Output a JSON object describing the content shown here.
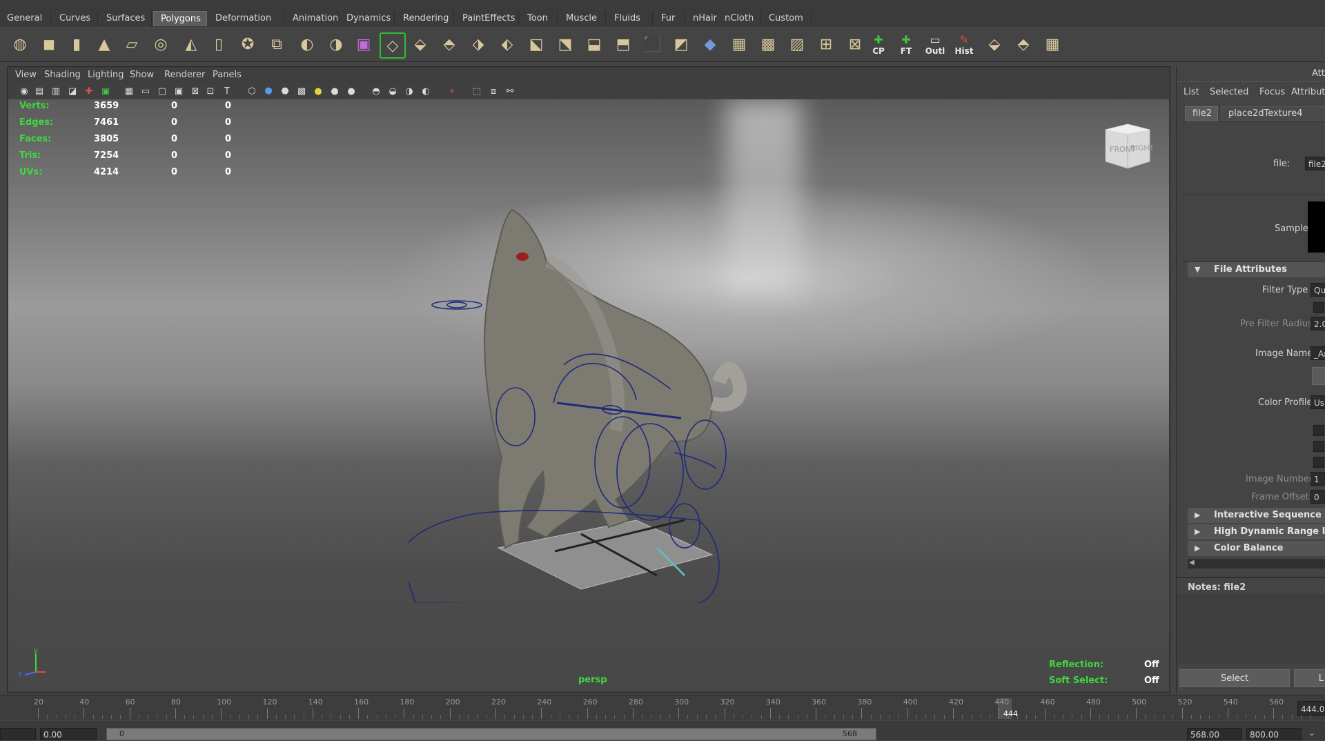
{
  "shelf_tabs": [
    {
      "label": "General"
    },
    {
      "label": "Curves"
    },
    {
      "label": "Surfaces"
    },
    {
      "label": "Polygons",
      "active": true
    },
    {
      "label": "Deformation"
    },
    {
      "label": "Animation"
    },
    {
      "label": "Dynamics"
    },
    {
      "label": "Rendering"
    },
    {
      "label": "PaintEffects"
    },
    {
      "label": "Toon"
    },
    {
      "label": "Muscle"
    },
    {
      "label": "Fluids"
    },
    {
      "label": "Fur"
    },
    {
      "label": "nHair"
    },
    {
      "label": "nCloth"
    },
    {
      "label": "Custom"
    }
  ],
  "shelf_text_buttons": {
    "cp": "CP",
    "ft": "FT",
    "outl": "Outl",
    "hist": "Hist"
  },
  "panel_menu": {
    "view": "View",
    "shading": "Shading",
    "lighting": "Lighting",
    "show": "Show",
    "renderer": "Renderer",
    "panels": "Panels"
  },
  "hud": {
    "rows": [
      {
        "label": "Verts:",
        "v1": "3659",
        "v2": "0",
        "v3": "0"
      },
      {
        "label": "Edges:",
        "v1": "7461",
        "v2": "0",
        "v3": "0"
      },
      {
        "label": "Faces:",
        "v1": "3805",
        "v2": "0",
        "v3": "0"
      },
      {
        "label": "Tris:",
        "v1": "7254",
        "v2": "0",
        "v3": "0"
      },
      {
        "label": "UVs:",
        "v1": "4214",
        "v2": "0",
        "v3": "0"
      }
    ],
    "camera": "persp",
    "reflection_label": "Reflection:",
    "reflection_value": "Off",
    "soft_select_label": "Soft Select:",
    "soft_select_value": "Off",
    "view_cube": {
      "front": "FRONT",
      "right": "RIGHT"
    },
    "axis": {
      "y": "y",
      "z": "z"
    }
  },
  "attribute_editor": {
    "title_fragment": "Att",
    "menu": {
      "list": "List",
      "selected": "Selected",
      "focus": "Focus",
      "attributes": "Attribute"
    },
    "tabs": {
      "file2": "file2",
      "place2d": "place2dTexture4"
    },
    "file_label": "file:",
    "file_value": "file2",
    "sample_label": "Sample",
    "sections": {
      "file_attributes": "File Attributes",
      "interactive_sequence": "Interactive Sequence Ca",
      "hdr": "High Dynamic Range Ima",
      "color_balance": "Color Balance"
    },
    "filter_type_label": "Filter Type",
    "filter_type_value": "Qu",
    "pre_filter_radius_label": "Pre Filter Radius",
    "pre_filter_radius_value": "2.0",
    "image_name_label": "Image Name",
    "image_name_value": "_Ar",
    "color_profile_label": "Color Profile",
    "color_profile_value": "Us",
    "image_number_label": "Image Number",
    "image_number_value": "1",
    "frame_offset_label": "Frame Offset",
    "frame_offset_value": "0",
    "notes": "Notes:  file2",
    "select_button": "Select",
    "load_button_fragment": "L"
  },
  "time_slider": {
    "ticks": [
      "20",
      "40",
      "60",
      "80",
      "100",
      "120",
      "140",
      "160",
      "180",
      "200",
      "220",
      "240",
      "260",
      "280",
      "300",
      "320",
      "340",
      "360",
      "380",
      "400",
      "420",
      "440",
      "460",
      "480",
      "500",
      "520",
      "540",
      "560"
    ],
    "current_frame": "444",
    "current_field": "444.0"
  },
  "range": {
    "start_field": "0.00",
    "range_start": "0",
    "range_end": "568",
    "end_field": "568.00",
    "anim_end": "800.00"
  }
}
